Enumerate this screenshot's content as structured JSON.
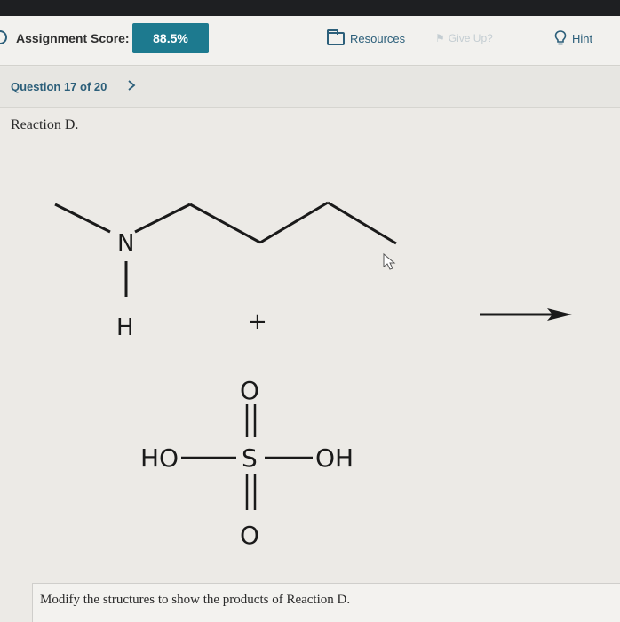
{
  "header": {
    "score_label": "Assignment Score:",
    "score_value": "88.5%",
    "resources_label": "Resources",
    "giveup_label": "Give Up?",
    "hint_label": "Hint"
  },
  "question_nav": {
    "label": "Question 17 of 20"
  },
  "main": {
    "reaction_title": "Reaction D.",
    "instruction": "Modify the structures to show the products of Reaction D."
  },
  "diagram": {
    "amine": {
      "n_label": "N",
      "h_label": "H"
    },
    "plus": "+",
    "sulfuric_acid": {
      "top_o": "O",
      "bottom_o": "O",
      "s_label": "S",
      "left_group": "HO",
      "right_group": "OH"
    }
  },
  "colors": {
    "accent": "#1d7a8f",
    "link": "#2c5f7a",
    "topbar": "#1e1f22"
  }
}
